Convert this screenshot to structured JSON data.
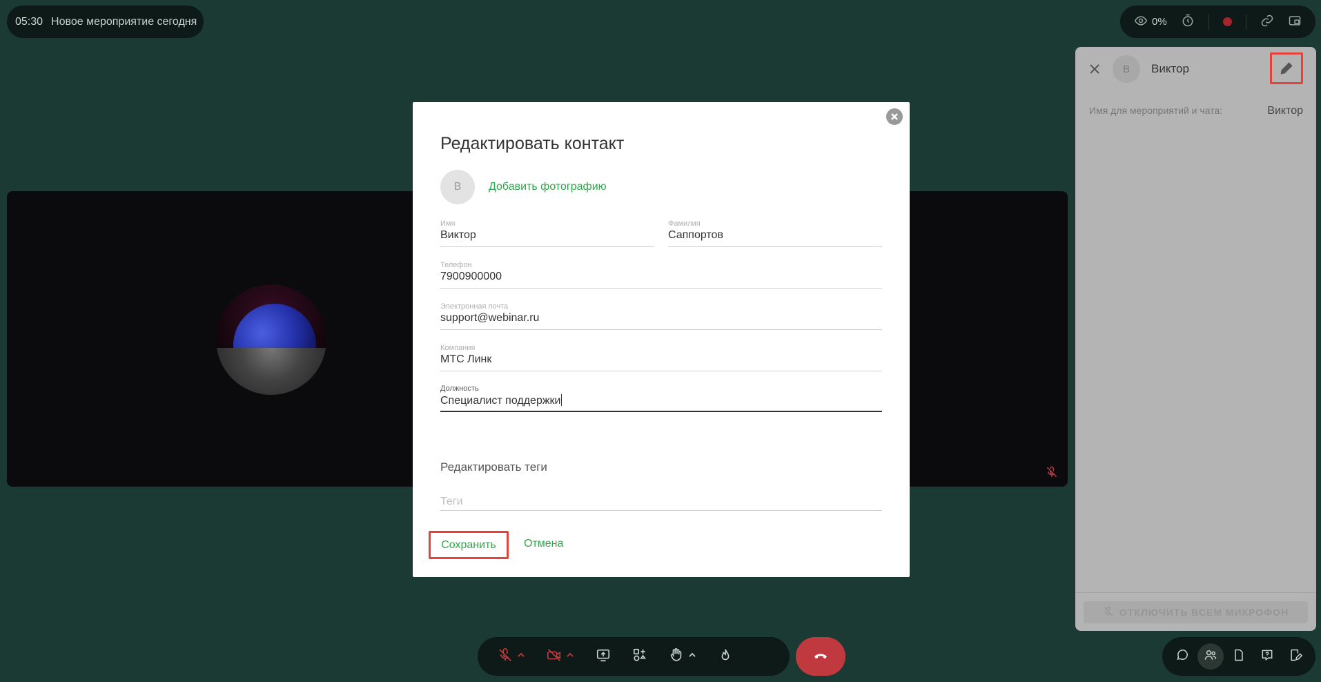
{
  "header": {
    "time": "05:30",
    "event_title": "Новое мероприятие сегодня"
  },
  "top_toolbar": {
    "views_percent": "0%"
  },
  "participant": {
    "initial": "B",
    "name": "Виктор",
    "field_label": "Имя для мероприятий и чата:",
    "field_value": "Виктор"
  },
  "side_panel": {
    "mute_all_label": "ОТКЛЮЧИТЬ ВСЕМ МИКРОФОН"
  },
  "modal": {
    "title": "Редактировать контакт",
    "avatar_initial": "B",
    "add_photo": "Добавить фотографию",
    "fields": {
      "first_name": {
        "label": "Имя",
        "value": "Виктор"
      },
      "last_name": {
        "label": "Фамилия",
        "value": "Саппортов"
      },
      "phone": {
        "label": "Телефон",
        "value": "7900900000"
      },
      "email": {
        "label": "Электронная почта",
        "value": "support@webinar.ru"
      },
      "company": {
        "label": "Компания",
        "value": "МТС Линк"
      },
      "position": {
        "label": "Должность",
        "value": "Специалист поддержки"
      }
    },
    "tags_title": "Редактировать теги",
    "tags_placeholder": "Теги",
    "save": "Сохранить",
    "cancel": "Отмена"
  },
  "colors": {
    "background": "#1b3a33",
    "accent_green": "#2fa84a",
    "hangup_red": "#c0393f",
    "highlight_red": "#e4433b"
  },
  "icons": {
    "top": [
      "eye-icon",
      "timer-icon",
      "record-icon",
      "link-icon",
      "pip-icon"
    ],
    "bottom": [
      "mic-off-icon",
      "camera-off-icon",
      "screen-share-icon",
      "apps-icon",
      "hand-icon",
      "fire-icon",
      "more-icon",
      "hangup-icon"
    ],
    "bottom_right": [
      "chat-icon",
      "participants-icon",
      "files-icon",
      "help-icon",
      "notes-icon"
    ]
  }
}
